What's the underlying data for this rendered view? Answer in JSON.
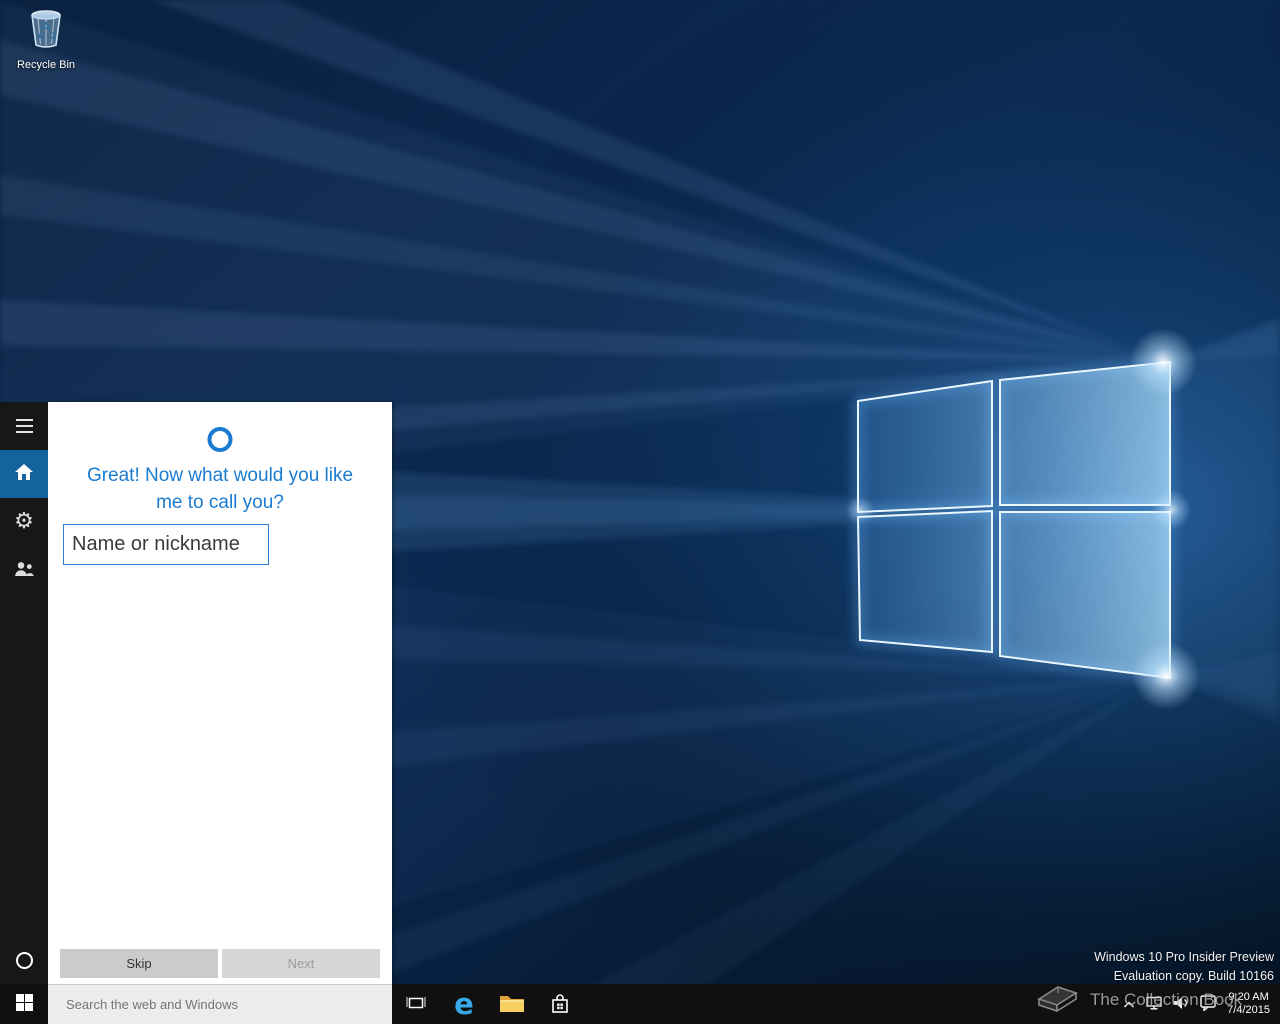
{
  "desktop": {
    "recycle_bin": {
      "label": "Recycle Bin"
    }
  },
  "cortana": {
    "panel": {
      "prompt_line1": "Great! Now what would you like",
      "prompt_line2": "me to call you?",
      "name_input": {
        "placeholder": "Name or nickname",
        "value": ""
      },
      "buttons": {
        "skip": "Skip",
        "next": "Next"
      }
    }
  },
  "taskbar": {
    "search": {
      "placeholder": "Search the web and Windows"
    },
    "clock": {
      "time": "9:20 AM",
      "date": "7/4/2015"
    }
  },
  "watermarks": {
    "build": {
      "line1": "Windows 10 Pro Insider Preview",
      "line2": "Evaluation copy. Build 10166"
    },
    "collection": {
      "text": "The Collection Book"
    }
  },
  "icons": {
    "settings_glyph": "⚙",
    "edge_glyph": "e"
  },
  "colors": {
    "cortana_blue": "#1b7bd0",
    "sidebar_active_tile": "#15639e",
    "taskbar_bg": "#101010",
    "panel_bg": "#ffffff",
    "wallpaper_base": "#0a2342",
    "folder_yellow": "#f7cf5f",
    "edge_blue": "#38a9e8"
  }
}
